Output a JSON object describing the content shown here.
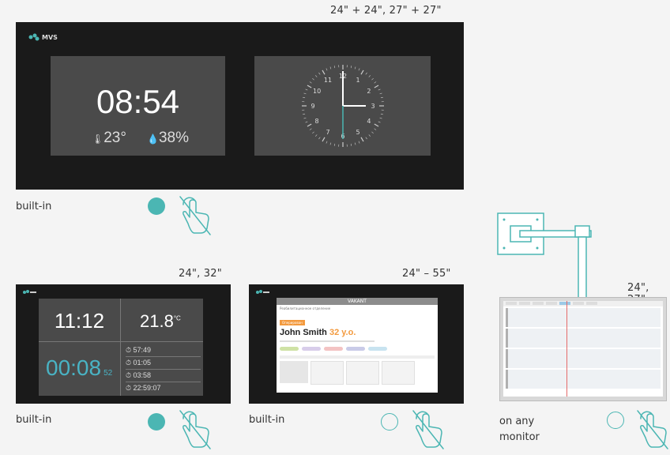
{
  "products": [
    {
      "size": "24\" + 24\", 27\" + 27\"",
      "logo": "MVS",
      "digital": {
        "time": "08:54",
        "temp": "23°",
        "humidity": "38%"
      },
      "clock_numbers": [
        "12",
        "1",
        "2",
        "3",
        "4",
        "5",
        "6",
        "7",
        "8",
        "9",
        "10",
        "11"
      ],
      "caption": "built-in",
      "touch": true
    },
    {
      "size": "24\", 32\"",
      "time": "11:12",
      "temp": "21.8",
      "temp_unit": "°C",
      "stopwatch": "00:08",
      "stopwatch_sub": "52",
      "laps": [
        "57:49",
        "01:05",
        "03:58",
        "22:59:07"
      ],
      "caption": "built-in",
      "touch": true
    },
    {
      "size": "24\" – 55\"",
      "header": "VAKANT",
      "subheader": "Реабилитационное отделение",
      "badge": "Оперирован",
      "patient_name": "John Smith",
      "patient_age": "32 y.o.",
      "caption": "built-in",
      "touch": false
    },
    {
      "size": "24\", 27\"",
      "caption_line1": "on any",
      "caption_line2": "monitor",
      "touch": false
    }
  ],
  "colors": {
    "accent": "#4bb6b3",
    "screen": "#1a1a1a",
    "panel": "#4a4a4a",
    "stopwatch": "#49b3c4",
    "orange": "#f39a3e"
  }
}
